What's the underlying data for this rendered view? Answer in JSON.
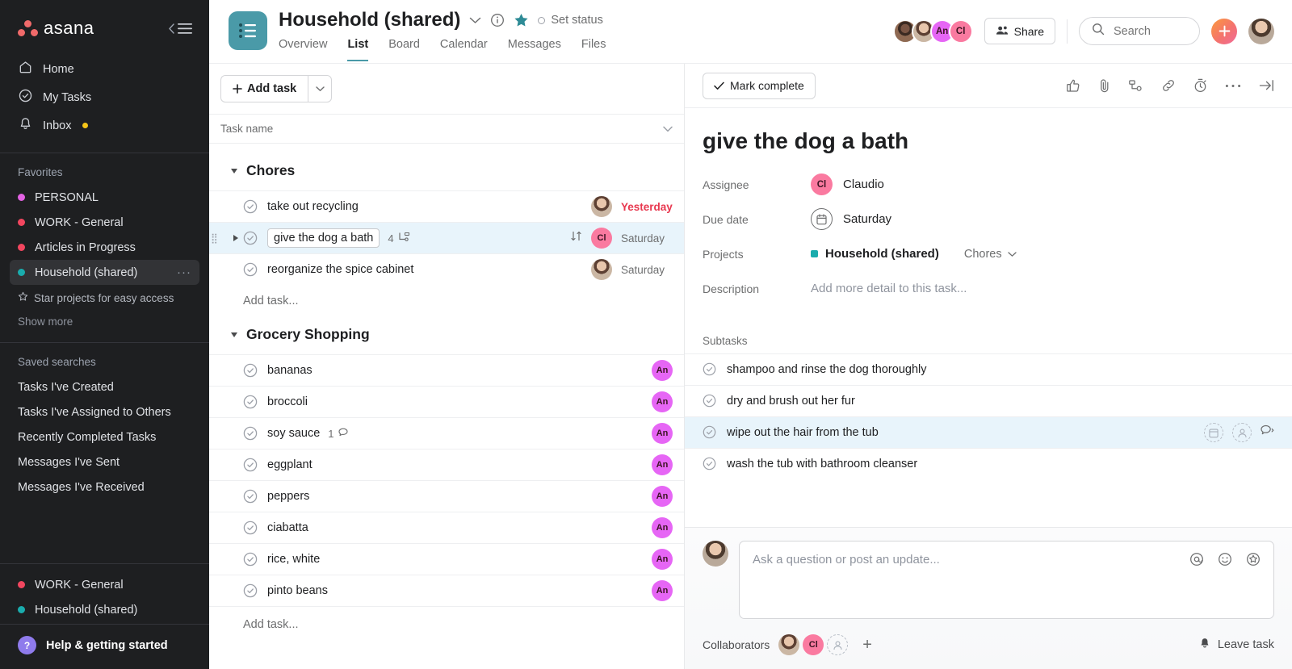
{
  "sidebar": {
    "brand": "asana",
    "collapse_icon": "collapse-sidebar-icon",
    "nav": [
      {
        "label": "Home",
        "icon": "home-icon"
      },
      {
        "label": "My Tasks",
        "icon": "check-circle-icon"
      },
      {
        "label": "Inbox",
        "icon": "bell-icon",
        "badge": true
      }
    ],
    "favorites_title": "Favorites",
    "favorites": [
      {
        "label": "PERSONAL",
        "color": "#e362e3"
      },
      {
        "label": "WORK - General",
        "color": "#f2465f"
      },
      {
        "label": "Articles in Progress",
        "color": "#f2465f"
      },
      {
        "label": "Household (shared)",
        "color": "#1aacad",
        "active": true,
        "more": "···"
      }
    ],
    "star_hint": "Star projects for easy access",
    "show_more": "Show more",
    "saved_title": "Saved searches",
    "saved_searches": [
      "Tasks I've Created",
      "Tasks I've Assigned to Others",
      "Recently Completed Tasks",
      "Messages I've Sent",
      "Messages I've Received"
    ],
    "projects": [
      {
        "label": "WORK - General",
        "color": "#f2465f"
      },
      {
        "label": "Household (shared)",
        "color": "#1aacad"
      }
    ],
    "help": {
      "label": "Help & getting started",
      "glyph": "?"
    }
  },
  "header": {
    "project_title": "Household (shared)",
    "project_icon": "list-project-icon",
    "caret_icon": "chevron-down-icon",
    "info_icon": "info-icon",
    "star_icon": "star-filled-icon",
    "star_color": "#2e8b96",
    "set_status": "Set status",
    "tabs": [
      {
        "label": "Overview",
        "active": false
      },
      {
        "label": "List",
        "active": true
      },
      {
        "label": "Board",
        "active": false
      },
      {
        "label": "Calendar",
        "active": false
      },
      {
        "label": "Messages",
        "active": false
      },
      {
        "label": "Files",
        "active": false
      }
    ],
    "members": [
      {
        "type": "photo",
        "initials": ""
      },
      {
        "type": "photo",
        "initials": ""
      },
      {
        "type": "initials",
        "initials": "An",
        "color": "#e666f5"
      },
      {
        "type": "initials",
        "initials": "Cl",
        "color": "#fa7aa0"
      }
    ],
    "share_label": "Share",
    "share_icon": "people-icon",
    "search": {
      "placeholder": "Search",
      "icon": "search-icon"
    },
    "plus_icon": "plus-icon",
    "avatar_icon": "user-avatar"
  },
  "list": {
    "add_task_label": "Add task",
    "add_task_caret": "chevron-down-icon",
    "column_header": "Task name",
    "header_caret": "chevron-down-icon",
    "sections": [
      {
        "title": "Chores",
        "add_task": "Add task...",
        "tasks": [
          {
            "name": "take out recycling",
            "due": "Yesterday",
            "overdue": true,
            "assignee": {
              "type": "photo",
              "initials": ""
            },
            "selected": false
          },
          {
            "name": "give the dog a bath",
            "due": "Saturday",
            "overdue": false,
            "assignee": {
              "type": "initials",
              "initials": "Cl",
              "color": "#fa7aa0"
            },
            "selected": true,
            "subtask_count": "4",
            "has_expand": true,
            "move_icon": "move-updown-icon"
          },
          {
            "name": "reorganize the spice cabinet",
            "due": "Saturday",
            "overdue": false,
            "assignee": {
              "type": "photo",
              "initials": ""
            },
            "selected": false
          }
        ]
      },
      {
        "title": "Grocery Shopping",
        "add_task": "Add task...",
        "tasks": [
          {
            "name": "bananas",
            "due": "",
            "assignee": {
              "type": "initials",
              "initials": "An",
              "color": "#e666f5"
            }
          },
          {
            "name": "broccoli",
            "due": "",
            "assignee": {
              "type": "initials",
              "initials": "An",
              "color": "#e666f5"
            }
          },
          {
            "name": "soy sauce",
            "due": "",
            "comment_count": "1",
            "assignee": {
              "type": "initials",
              "initials": "An",
              "color": "#e666f5"
            }
          },
          {
            "name": "eggplant",
            "due": "",
            "assignee": {
              "type": "initials",
              "initials": "An",
              "color": "#e666f5"
            }
          },
          {
            "name": "peppers",
            "due": "",
            "assignee": {
              "type": "initials",
              "initials": "An",
              "color": "#e666f5"
            }
          },
          {
            "name": "ciabatta",
            "due": "",
            "assignee": {
              "type": "initials",
              "initials": "An",
              "color": "#e666f5"
            }
          },
          {
            "name": "rice, white",
            "due": "",
            "assignee": {
              "type": "initials",
              "initials": "An",
              "color": "#e666f5"
            }
          },
          {
            "name": "pinto beans",
            "due": "",
            "assignee": {
              "type": "initials",
              "initials": "An",
              "color": "#e666f5"
            }
          }
        ]
      }
    ]
  },
  "detail": {
    "mark_complete": "Mark complete",
    "toolbar_icons": [
      "like-icon",
      "attach-icon",
      "subtask-icon",
      "link-icon",
      "timer-icon",
      "ellipsis-icon",
      "expand-right-icon"
    ],
    "title": "give the dog a bath",
    "fields": {
      "assignee_label": "Assignee",
      "assignee_name": "Claudio",
      "assignee_initials": "Cl",
      "assignee_color": "#fa7aa0",
      "due_label": "Due date",
      "due_value": "Saturday",
      "projects_label": "Projects",
      "project_name": "Household (shared)",
      "project_color": "#1aacad",
      "project_section": "Chores",
      "description_label": "Description",
      "description_placeholder": "Add more detail to this task..."
    },
    "subtasks_label": "Subtasks",
    "subtasks": [
      {
        "name": "shampoo and rinse the dog thoroughly",
        "hovered": false
      },
      {
        "name": "dry and brush out her fur",
        "hovered": false
      },
      {
        "name": "wipe out the hair from the tub",
        "hovered": true
      },
      {
        "name": "wash the tub with bathroom cleanser",
        "hovered": false
      }
    ],
    "comment": {
      "placeholder": "Ask a question or post an update...",
      "icons": [
        "mention-icon",
        "emoji-icon",
        "sticker-icon"
      ]
    },
    "collaborators_label": "Collaborators",
    "collaborators": [
      {
        "type": "photo",
        "initials": ""
      },
      {
        "type": "initials",
        "initials": "Cl",
        "color": "#fa7aa0"
      },
      {
        "type": "dashed",
        "initials": ""
      }
    ],
    "add_collaborator": "+",
    "leave_task": "Leave task",
    "leave_icon": "bell-icon"
  }
}
